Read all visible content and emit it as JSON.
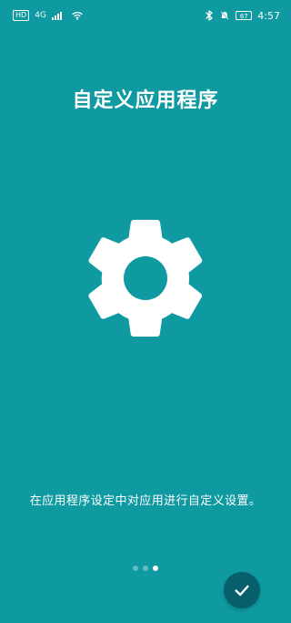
{
  "status_bar": {
    "hd": "HD",
    "network": "4G",
    "battery": "67",
    "time": "4:57"
  },
  "title": "自定义应用程序",
  "hero_icon": "gear-icon",
  "description": "在应用程序设定中对应用进行自定义设置。",
  "pager": {
    "page_count": 3,
    "active_index": 2
  },
  "done_button": {
    "icon": "check-icon"
  },
  "colors": {
    "background": "#0f9aa2",
    "button": "#065f6a",
    "text": "#ffffff"
  }
}
